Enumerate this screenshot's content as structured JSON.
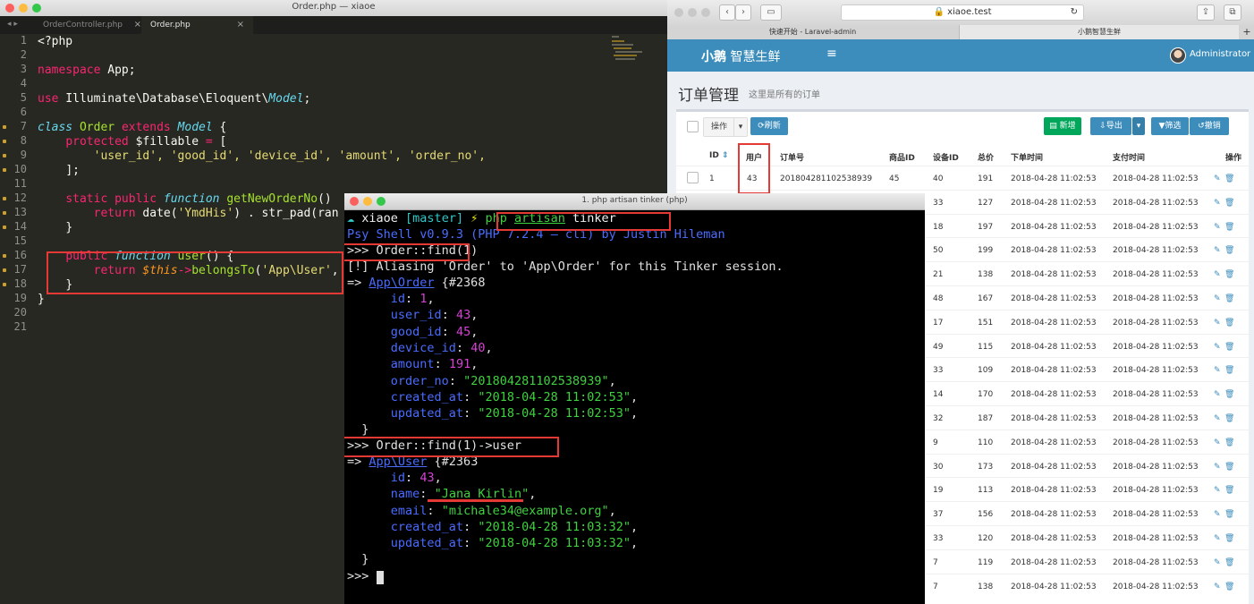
{
  "editor": {
    "window_title": "Order.php — xiaoe",
    "tabs": [
      "OrderController.php",
      "Order.php"
    ],
    "tab_close": "×",
    "line_numbers": [
      "1",
      "2",
      "3",
      "4",
      "5",
      "6",
      "7",
      "8",
      "9",
      "10",
      "11",
      "12",
      "13",
      "14",
      "15",
      "16",
      "17",
      "18",
      "19",
      "20",
      "21"
    ],
    "code": {
      "l1": "<?php",
      "l3_kw": "namespace",
      "l3_ns": " App;",
      "l5_kw": "use",
      "l5_path": " Illuminate\\Database\\Eloquent\\",
      "l5_cls": "Model",
      "l5_end": ";",
      "l7_kw": "class",
      "l7_name": " Order ",
      "l7_ext": "extends",
      "l7_cls": " Model",
      "l7_end": " {",
      "l8_kw": "protected",
      "l8_var": " $fillable",
      "l8_eq": " = ",
      "l8_end": "[",
      "l9": "'user_id', 'good_id', 'device_id', 'amount', 'order_no',",
      "l10": "];",
      "l12_a": "static public ",
      "l12_fn": "function",
      "l12_name": " getNewOrderNo",
      "l12_end": "()",
      "l13_kw": "return",
      "l13_a": " date(",
      "l13_s": "'YmdHis'",
      "l13_b": ") . str_pad(ran",
      "l14": "}",
      "l16_kw": "public",
      "l16_fn": " function",
      "l16_name": " user",
      "l16_end": "() {",
      "l17_kw": "return",
      "l17_this": " $this",
      "l17_a": "->",
      "l17_m": "belongsTo",
      "l17_b": "(",
      "l17_s": "'App\\User'",
      "l17_c": ",",
      "l18": "}",
      "l19": "}"
    }
  },
  "browser": {
    "address": "xiaoe.test",
    "tabs": [
      "快速开始 - Laravel-admin",
      "小鹅智慧生鲜"
    ],
    "new_tab": "+",
    "logo_bold": "小鹅",
    "logo_rest": " 智慧生鲜",
    "menu_icon": "≡",
    "user": "Administrator",
    "page_title": "订单管理",
    "page_subtitle": "这里是所有的订单",
    "toolbar": {
      "actions": "操作",
      "refresh": "刷新",
      "new": "新增",
      "export": "导出",
      "filter": "筛选",
      "undo": "撤销"
    },
    "columns": [
      "ID",
      "用户",
      "订单号",
      "商品ID",
      "设备ID",
      "总价",
      "下单时间",
      "支付时间",
      "操作"
    ],
    "rows": [
      {
        "id": "1",
        "user": "43",
        "order_no": "201804281102538939",
        "good": "45",
        "device": "40",
        "amount": "191",
        "created": "2018-04-28 11:02:53",
        "paid": "2018-04-28 11:02:53"
      },
      {
        "id": "",
        "user": "",
        "order_no": "",
        "good": "",
        "device": "33",
        "amount": "127",
        "created": "2018-04-28 11:02:53",
        "paid": "2018-04-28 11:02:53"
      },
      {
        "id": "",
        "user": "",
        "order_no": "",
        "good": "",
        "device": "18",
        "amount": "197",
        "created": "2018-04-28 11:02:53",
        "paid": "2018-04-28 11:02:53"
      },
      {
        "id": "",
        "user": "",
        "order_no": "",
        "good": "",
        "device": "50",
        "amount": "199",
        "created": "2018-04-28 11:02:53",
        "paid": "2018-04-28 11:02:53"
      },
      {
        "id": "",
        "user": "",
        "order_no": "",
        "good": "",
        "device": "21",
        "amount": "138",
        "created": "2018-04-28 11:02:53",
        "paid": "2018-04-28 11:02:53"
      },
      {
        "id": "",
        "user": "",
        "order_no": "",
        "good": "",
        "device": "48",
        "amount": "167",
        "created": "2018-04-28 11:02:53",
        "paid": "2018-04-28 11:02:53"
      },
      {
        "id": "",
        "user": "",
        "order_no": "",
        "good": "",
        "device": "17",
        "amount": "151",
        "created": "2018-04-28 11:02:53",
        "paid": "2018-04-28 11:02:53"
      },
      {
        "id": "",
        "user": "",
        "order_no": "",
        "good": "",
        "device": "49",
        "amount": "115",
        "created": "2018-04-28 11:02:53",
        "paid": "2018-04-28 11:02:53"
      },
      {
        "id": "",
        "user": "",
        "order_no": "",
        "good": "",
        "device": "33",
        "amount": "109",
        "created": "2018-04-28 11:02:53",
        "paid": "2018-04-28 11:02:53"
      },
      {
        "id": "",
        "user": "",
        "order_no": "",
        "good": "",
        "device": "14",
        "amount": "170",
        "created": "2018-04-28 11:02:53",
        "paid": "2018-04-28 11:02:53"
      },
      {
        "id": "",
        "user": "",
        "order_no": "",
        "good": "",
        "device": "32",
        "amount": "187",
        "created": "2018-04-28 11:02:53",
        "paid": "2018-04-28 11:02:53"
      },
      {
        "id": "",
        "user": "",
        "order_no": "",
        "good": "",
        "device": "9",
        "amount": "110",
        "created": "2018-04-28 11:02:53",
        "paid": "2018-04-28 11:02:53"
      },
      {
        "id": "",
        "user": "",
        "order_no": "",
        "good": "",
        "device": "30",
        "amount": "173",
        "created": "2018-04-28 11:02:53",
        "paid": "2018-04-28 11:02:53"
      },
      {
        "id": "",
        "user": "",
        "order_no": "",
        "good": "",
        "device": "19",
        "amount": "113",
        "created": "2018-04-28 11:02:53",
        "paid": "2018-04-28 11:02:53"
      },
      {
        "id": "",
        "user": "",
        "order_no": "",
        "good": "",
        "device": "37",
        "amount": "156",
        "created": "2018-04-28 11:02:53",
        "paid": "2018-04-28 11:02:53"
      },
      {
        "id": "",
        "user": "",
        "order_no": "",
        "good": "",
        "device": "33",
        "amount": "120",
        "created": "2018-04-28 11:02:53",
        "paid": "2018-04-28 11:02:53"
      },
      {
        "id": "",
        "user": "",
        "order_no": "",
        "good": "",
        "device": "7",
        "amount": "119",
        "created": "2018-04-28 11:02:53",
        "paid": "2018-04-28 11:02:53"
      },
      {
        "id": "",
        "user": "",
        "order_no": "",
        "good": "",
        "device": "7",
        "amount": "138",
        "created": "2018-04-28 11:02:53",
        "paid": "2018-04-28 11:02:53"
      }
    ]
  },
  "terminal": {
    "title": "1. php artisan tinker (php)",
    "prompt_user": " xiaoe",
    "prompt_branch": " [master]",
    "prompt_bolt": " ⚡ ",
    "cmd_php": "php",
    "cmd_artisan": "artisan",
    "cmd_tinker": " tinker",
    "psy": "Psy Shell v0.9.3 (PHP 7.2.4 — cli) by Justin Hileman",
    "in1": ">>> Order::find(1)",
    "alias": "[!] Aliasing 'Order' to 'App\\Order' for this Tinker session.",
    "out1_arrow": "=> ",
    "out1_class": "App\\Order",
    "out1_ref": " {#2368",
    "order_fields": [
      {
        "key": "id",
        "val": "1",
        "type": "num"
      },
      {
        "key": "user_id",
        "val": "43",
        "type": "num"
      },
      {
        "key": "good_id",
        "val": "45",
        "type": "num"
      },
      {
        "key": "device_id",
        "val": "40",
        "type": "num"
      },
      {
        "key": "amount",
        "val": "191",
        "type": "num"
      },
      {
        "key": "order_no",
        "val": "\"201804281102538939\"",
        "type": "str"
      },
      {
        "key": "created_at",
        "val": "\"2018-04-28 11:02:53\"",
        "type": "str"
      },
      {
        "key": "updated_at",
        "val": "\"2018-04-28 11:02:53\"",
        "type": "str"
      }
    ],
    "close1": "}",
    "in2": ">>> Order::find(1)->user",
    "out2_arrow": "=> ",
    "out2_class": "App\\User",
    "out2_ref": " {#2363",
    "user_fields": [
      {
        "key": "id",
        "val": "43",
        "type": "num"
      },
      {
        "key": "name",
        "val": "\"Jana Kirlin\"",
        "type": "str"
      },
      {
        "key": "email",
        "val": "\"michale34@example.org\"",
        "type": "str"
      },
      {
        "key": "created_at",
        "val": "\"2018-04-28 11:03:32\"",
        "type": "str"
      },
      {
        "key": "updated_at",
        "val": "\"2018-04-28 11:03:32\"",
        "type": "str"
      }
    ],
    "close2": "}",
    "prompt_end": ">>> "
  },
  "colors": {
    "highlight_red": "#e53935",
    "admin_blue": "#3c8dbc",
    "term_green": "#3fd13f",
    "term_magenta": "#d542d5",
    "term_blue": "#4a6cff"
  }
}
